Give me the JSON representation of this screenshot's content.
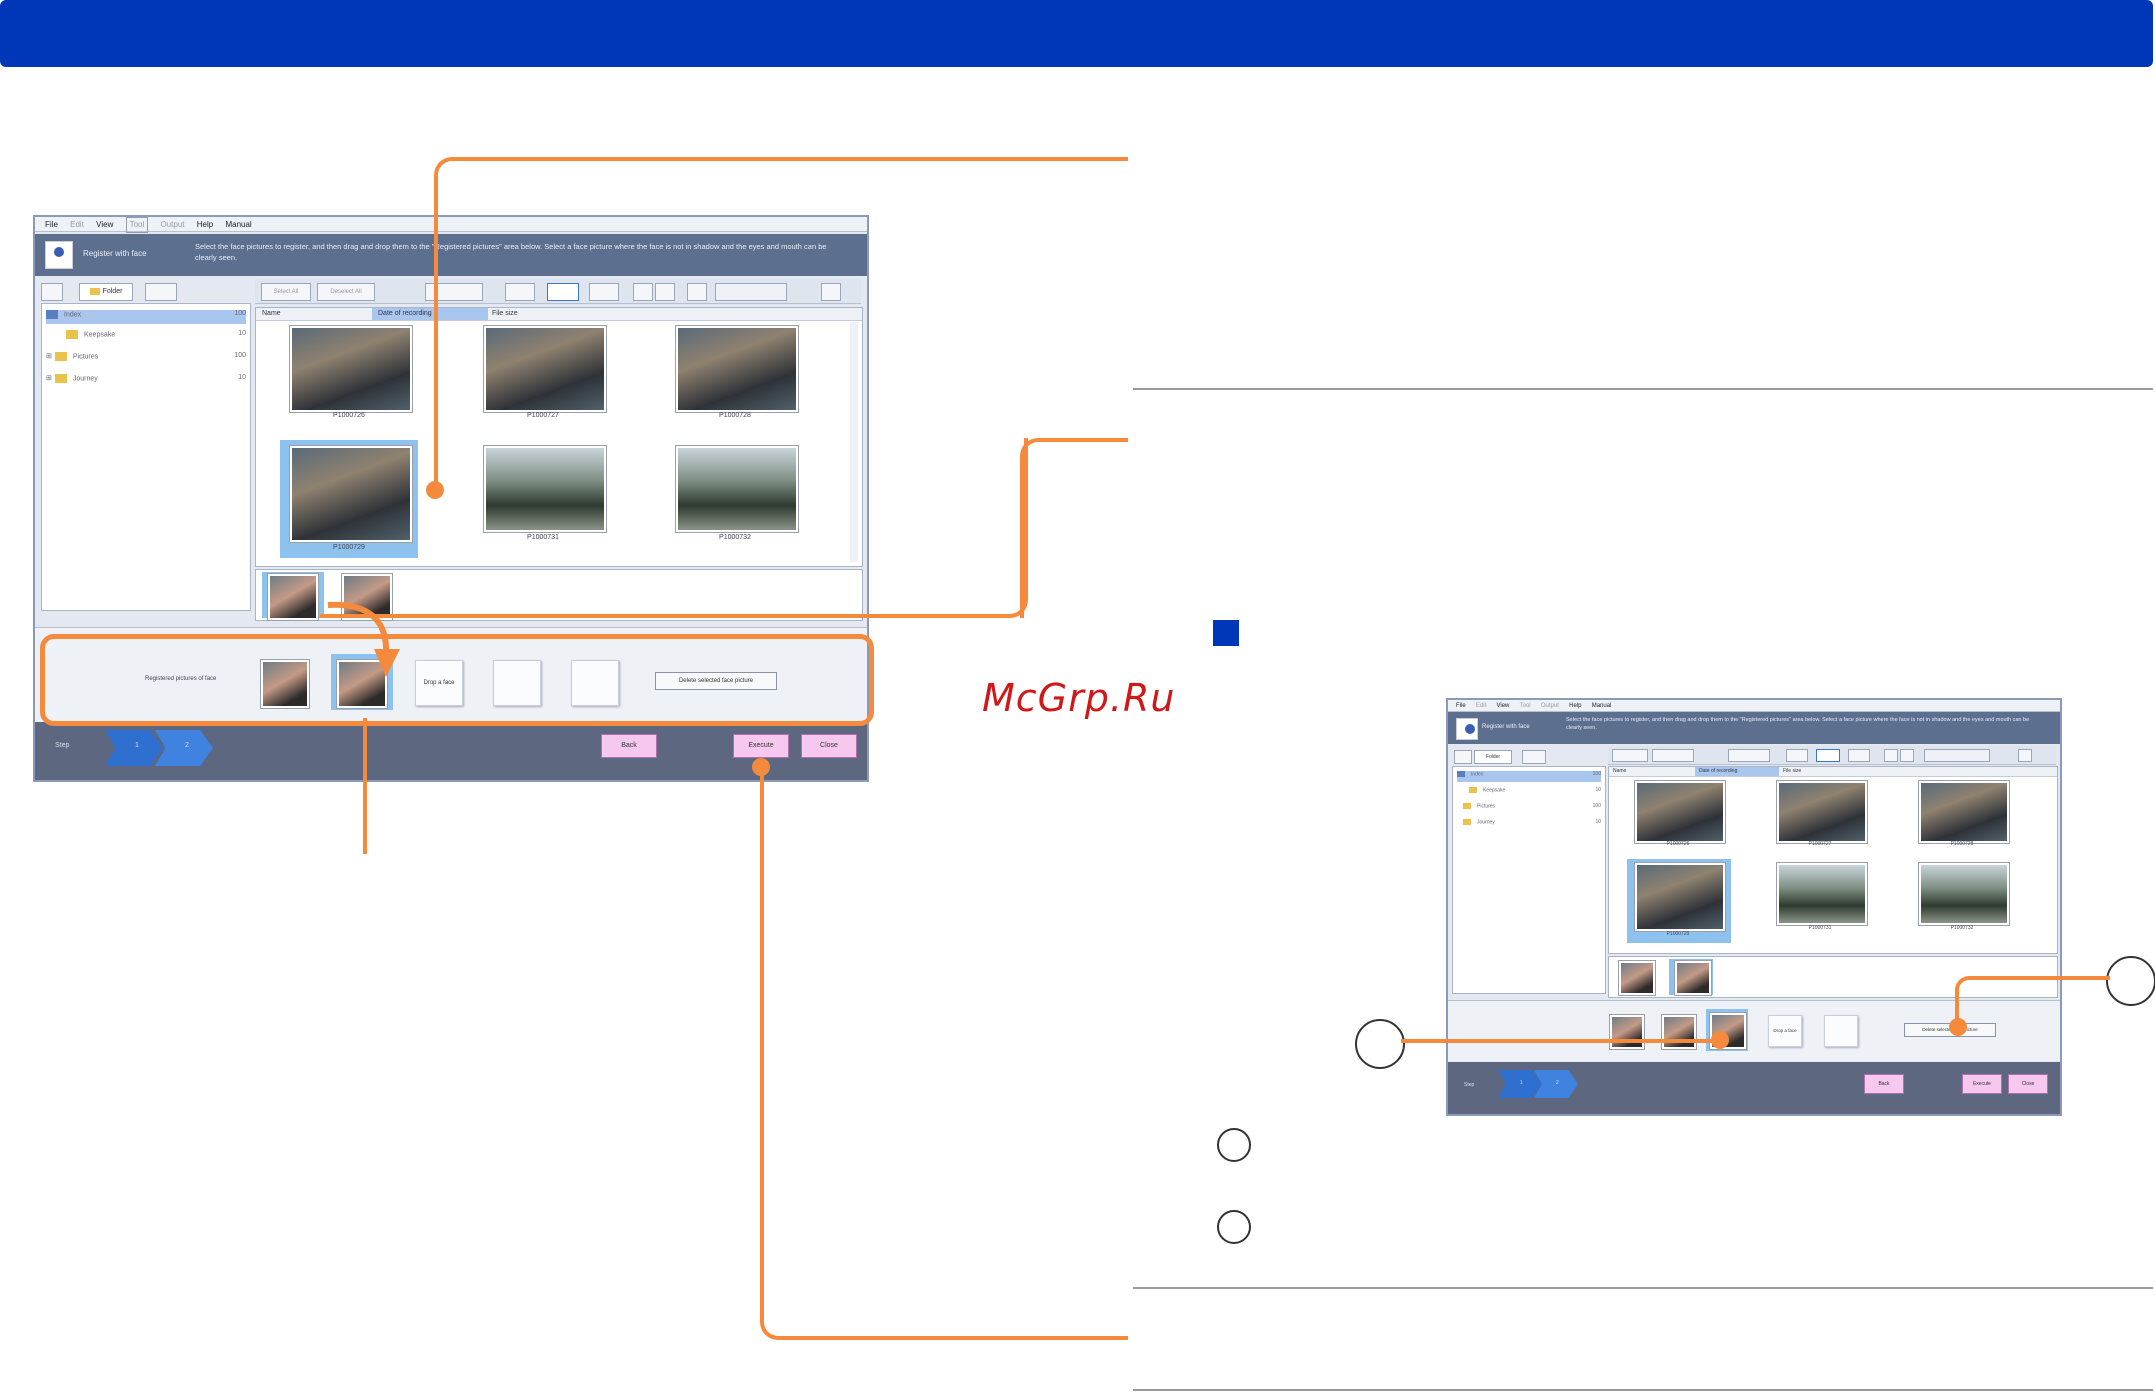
{
  "brand": {
    "header_color": "#0036b8",
    "accent_color": "#f58a3c",
    "watermark": "McGrp.Ru",
    "watermark_color": "#d01818"
  },
  "main_screenshot": {
    "menu": [
      "File",
      "Edit",
      "View",
      "Tool",
      "Output",
      "Help",
      "Manual"
    ],
    "info_title": "Register with face",
    "info_text": "Select the face pictures to register, and then drag and drop them to the \"Registered pictures\" area below. Select a face picture where the face is not in shadow and the eyes and mouth can be clearly seen.",
    "tab_label": "Folder",
    "tree_items": [
      {
        "label": "Index",
        "count": "100"
      },
      {
        "label": "Keepsake",
        "count": "10"
      },
      {
        "label": "Pictures",
        "count": "100"
      },
      {
        "label": "Journey",
        "count": "10"
      }
    ],
    "toolbar_buttons": [
      "Select All",
      "Deselect All"
    ],
    "columns": [
      "Name",
      "Date of recording",
      "File size"
    ],
    "thumbnails": [
      "P1000726",
      "P1000727",
      "P1000728",
      "P1000729",
      "P1000731",
      "P1000732"
    ],
    "register_label": "Registered pictures of face",
    "drop_label": "Drop a face",
    "delete_button": "Delete selected face picture",
    "steps": [
      "Step",
      "1",
      "2"
    ],
    "buttons": {
      "back": "Back",
      "execute": "Execute",
      "close": "Close"
    }
  },
  "small_screenshot": {
    "menu": [
      "File",
      "Edit",
      "View",
      "Tool",
      "Output",
      "Help",
      "Manual"
    ],
    "info_title": "Register with face",
    "info_text": "Select the face pictures to register, and then drag and drop them to the \"Registered pictures\" area below. Select a face picture where the face is not in shadow and the eyes and mouth can be clearly seen.",
    "tab_label": "Folder",
    "tree_items": [
      {
        "label": "Index",
        "count": "100"
      },
      {
        "label": "Keepsake",
        "count": "10"
      },
      {
        "label": "Pictures",
        "count": "100"
      },
      {
        "label": "Journey",
        "count": "10"
      }
    ],
    "columns": [
      "Name",
      "Date of recording",
      "File size"
    ],
    "thumbnails": [
      "P1000726",
      "P1000727",
      "P1000728",
      "P1000729",
      "P1000731",
      "P1000732"
    ],
    "drop_label": "Drop a face",
    "delete_button": "Delete selected face picture",
    "steps": [
      "Step",
      "1",
      "2"
    ],
    "buttons": {
      "back": "Back",
      "execute": "Execute",
      "close": "Close"
    }
  }
}
